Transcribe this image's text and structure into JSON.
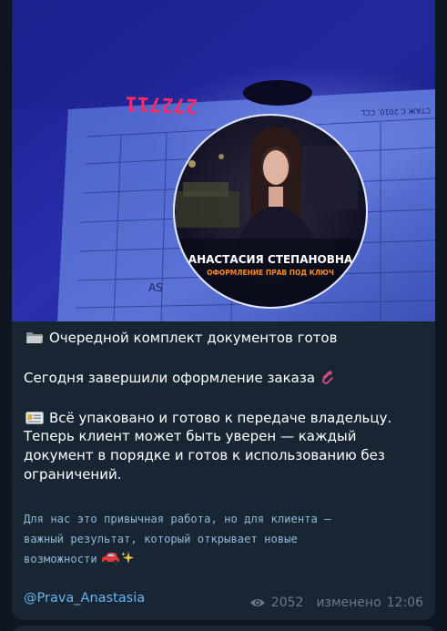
{
  "colors": {
    "background": "#0e1621",
    "bubble": "#182533",
    "text": "#ffffff",
    "mono_text": "#8fb8d6",
    "link": "#6ab3f3",
    "meta": "#6c7883",
    "badge_accent": "#ff8a1e"
  },
  "photo": {
    "icon": "uv-license-photo",
    "document_number": "272711",
    "badge": {
      "name": "АНАСТАСИЯ СТЕПАНОВНА",
      "subtitle": "ОФОРМЛЕНИЕ ПРАВ ПОД КЛЮЧ"
    }
  },
  "message": {
    "headline": "Очередной комплект документов готов",
    "headline_icon": "folder-icon",
    "line2": "Сегодня завершили оформление заказа",
    "line2_icon": "paperclip-icon",
    "paragraph_icon": "id-card-icon",
    "paragraph_lines": [
      "Всё упаковано и готово к передаче владельцу.",
      "Теперь клиент может быть уверен — каждый",
      "документ в порядке и готов к использованию без",
      "ограничений."
    ],
    "mono_lines": [
      "Для нас это привычная работа, но для клиента —",
      "важный результат, который открывает новые",
      "возможности"
    ],
    "mono_icons": [
      "car-icon",
      "sparkles-icon"
    ],
    "signature": "@Prava_Anastasia"
  },
  "meta": {
    "views_icon": "eye-icon",
    "views": "2052",
    "edited_label": "изменено",
    "time": "12:06"
  }
}
